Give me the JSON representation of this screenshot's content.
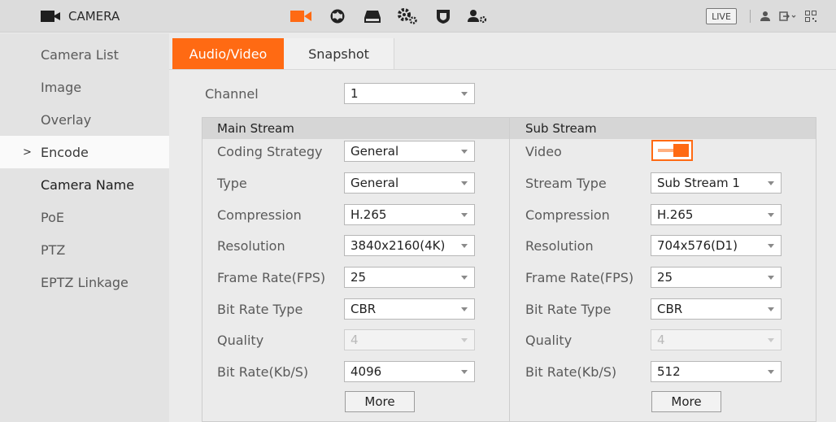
{
  "header": {
    "app_title": "CAMERA",
    "nav_icons": [
      "camera-icon",
      "network-icon",
      "storage-icon",
      "system-settings-icon",
      "security-icon",
      "account-icon"
    ],
    "live_label": "LIVE",
    "right_icons": [
      "user-icon",
      "logout-icon",
      "qr-code-icon"
    ],
    "accent_color": "#ff6a13"
  },
  "sidebar": {
    "items": [
      {
        "label": "Camera List"
      },
      {
        "label": "Image"
      },
      {
        "label": "Overlay"
      },
      {
        "label": "Encode",
        "active": true
      },
      {
        "label": "Camera Name"
      },
      {
        "label": "PoE"
      },
      {
        "label": "PTZ"
      },
      {
        "label": "EPTZ Linkage"
      }
    ],
    "active_marker": ">"
  },
  "tabs": [
    {
      "label": "Audio/Video",
      "active": true
    },
    {
      "label": "Snapshot",
      "active": false
    }
  ],
  "channel": {
    "label": "Channel",
    "value": "1"
  },
  "main_stream": {
    "title": "Main Stream",
    "coding_strategy": {
      "label": "Coding Strategy",
      "value": "General"
    },
    "type": {
      "label": "Type",
      "value": "General"
    },
    "compression": {
      "label": "Compression",
      "value": "H.265"
    },
    "resolution": {
      "label": "Resolution",
      "value": "3840x2160(4K)"
    },
    "frame_rate": {
      "label": "Frame Rate(FPS)",
      "value": "25"
    },
    "bit_rate_type": {
      "label": "Bit Rate Type",
      "value": "CBR"
    },
    "quality": {
      "label": "Quality",
      "value": "4"
    },
    "bit_rate": {
      "label": "Bit Rate(Kb/S)",
      "value": "4096"
    },
    "more_label": "More"
  },
  "sub_stream": {
    "title": "Sub Stream",
    "video": {
      "label": "Video",
      "enabled": true
    },
    "stream_type": {
      "label": "Stream Type",
      "value": "Sub Stream 1"
    },
    "compression": {
      "label": "Compression",
      "value": "H.265"
    },
    "resolution": {
      "label": "Resolution",
      "value": "704x576(D1)"
    },
    "frame_rate": {
      "label": "Frame Rate(FPS)",
      "value": "25"
    },
    "bit_rate_type": {
      "label": "Bit Rate Type",
      "value": "CBR"
    },
    "quality": {
      "label": "Quality",
      "value": "4"
    },
    "bit_rate": {
      "label": "Bit Rate(Kb/S)",
      "value": "512"
    },
    "more_label": "More"
  }
}
